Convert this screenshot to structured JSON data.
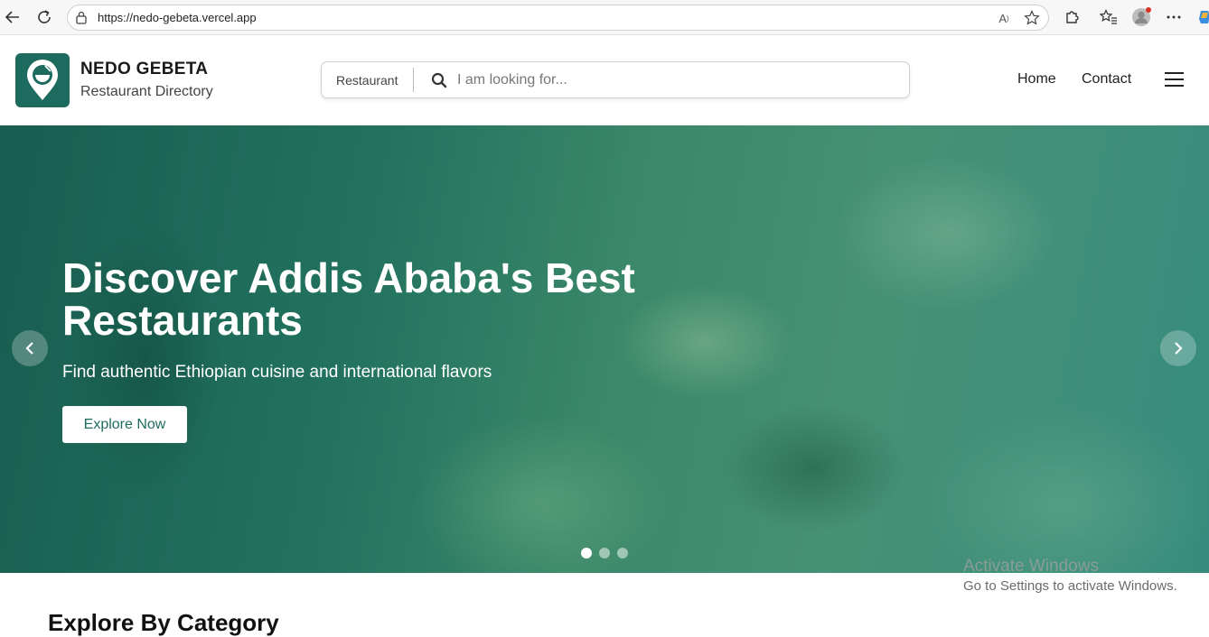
{
  "browser": {
    "url": "https://nedo-gebeta.vercel.app",
    "icons": [
      "back-icon",
      "refresh-icon",
      "lock-icon",
      "read-aloud-icon",
      "favorite-star-icon",
      "extensions-icon",
      "favorites-icon",
      "profile-avatar",
      "more-icon",
      "copilot-icon"
    ]
  },
  "header": {
    "brand_name": "NEDO GEBETA",
    "brand_tagline": "Restaurant Directory",
    "search": {
      "category": "Restaurant",
      "placeholder": "I am looking for..."
    },
    "nav": {
      "home": "Home",
      "contact": "Contact"
    },
    "brand_color": "#1d6b5f"
  },
  "hero": {
    "title": "Discover Addis Ababa's Best Restaurants",
    "subtitle": "Find authentic Ethiopian cuisine and international flavors",
    "cta": "Explore Now",
    "slide_count": 3,
    "active_slide": 1
  },
  "watermark": {
    "title": "Activate Windows",
    "subtitle": "Go to Settings to activate Windows."
  },
  "sections": {
    "explore_title": "Explore By Category"
  }
}
